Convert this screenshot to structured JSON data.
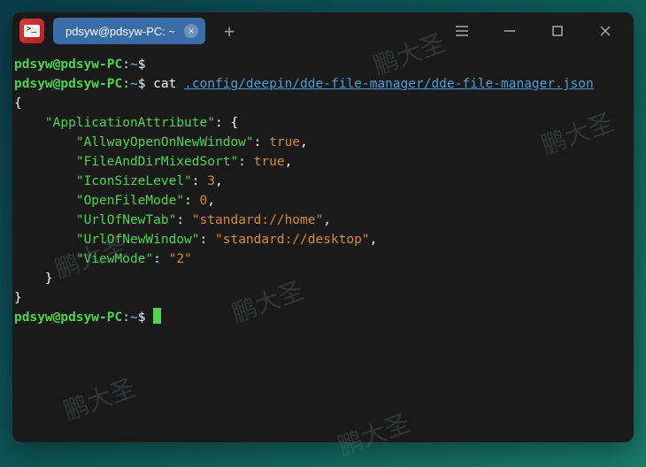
{
  "titlebar": {
    "tab": "pdsyw@pdsyw-PC: ~",
    "close_glyph": "×",
    "plus_glyph": "+"
  },
  "prompt": {
    "user": "pdsyw@pdsyw-PC",
    "sep": ":",
    "path": "~",
    "dollar": "$"
  },
  "cmd": "cat",
  "arg": ".config/deepin/dde-file-manager/dde-file-manager.json",
  "json": {
    "open": "{",
    "close": "}",
    "lines": [
      {
        "indent": "    ",
        "key": "\"ApplicationAttribute\"",
        "after": ": {"
      },
      {
        "indent": "        ",
        "key": "\"AllwayOpenOnNewWindow\"",
        "colon": ": ",
        "val": "true",
        "comma": ","
      },
      {
        "indent": "        ",
        "key": "\"FileAndDirMixedSort\"",
        "colon": ": ",
        "val": "true",
        "comma": ","
      },
      {
        "indent": "        ",
        "key": "\"IconSizeLevel\"",
        "colon": ": ",
        "val": "3",
        "comma": ","
      },
      {
        "indent": "        ",
        "key": "\"OpenFileMode\"",
        "colon": ": ",
        "val": "0",
        "comma": ","
      },
      {
        "indent": "        ",
        "key": "\"UrlOfNewTab\"",
        "colon": ": ",
        "val": "\"standard://home\"",
        "comma": ","
      },
      {
        "indent": "        ",
        "key": "\"UrlOfNewWindow\"",
        "colon": ": ",
        "val": "\"standard://desktop\"",
        "comma": ","
      },
      {
        "indent": "        ",
        "key": "\"ViewMode\"",
        "colon": ": ",
        "val": "\"2\"",
        "comma": ""
      },
      {
        "indent": "    ",
        "close": "}"
      }
    ]
  },
  "watermarks": [
    "鹏大圣",
    "鹏大圣",
    "鹏大圣",
    "鹏大圣",
    "鹏大圣",
    "鹏大圣"
  ]
}
